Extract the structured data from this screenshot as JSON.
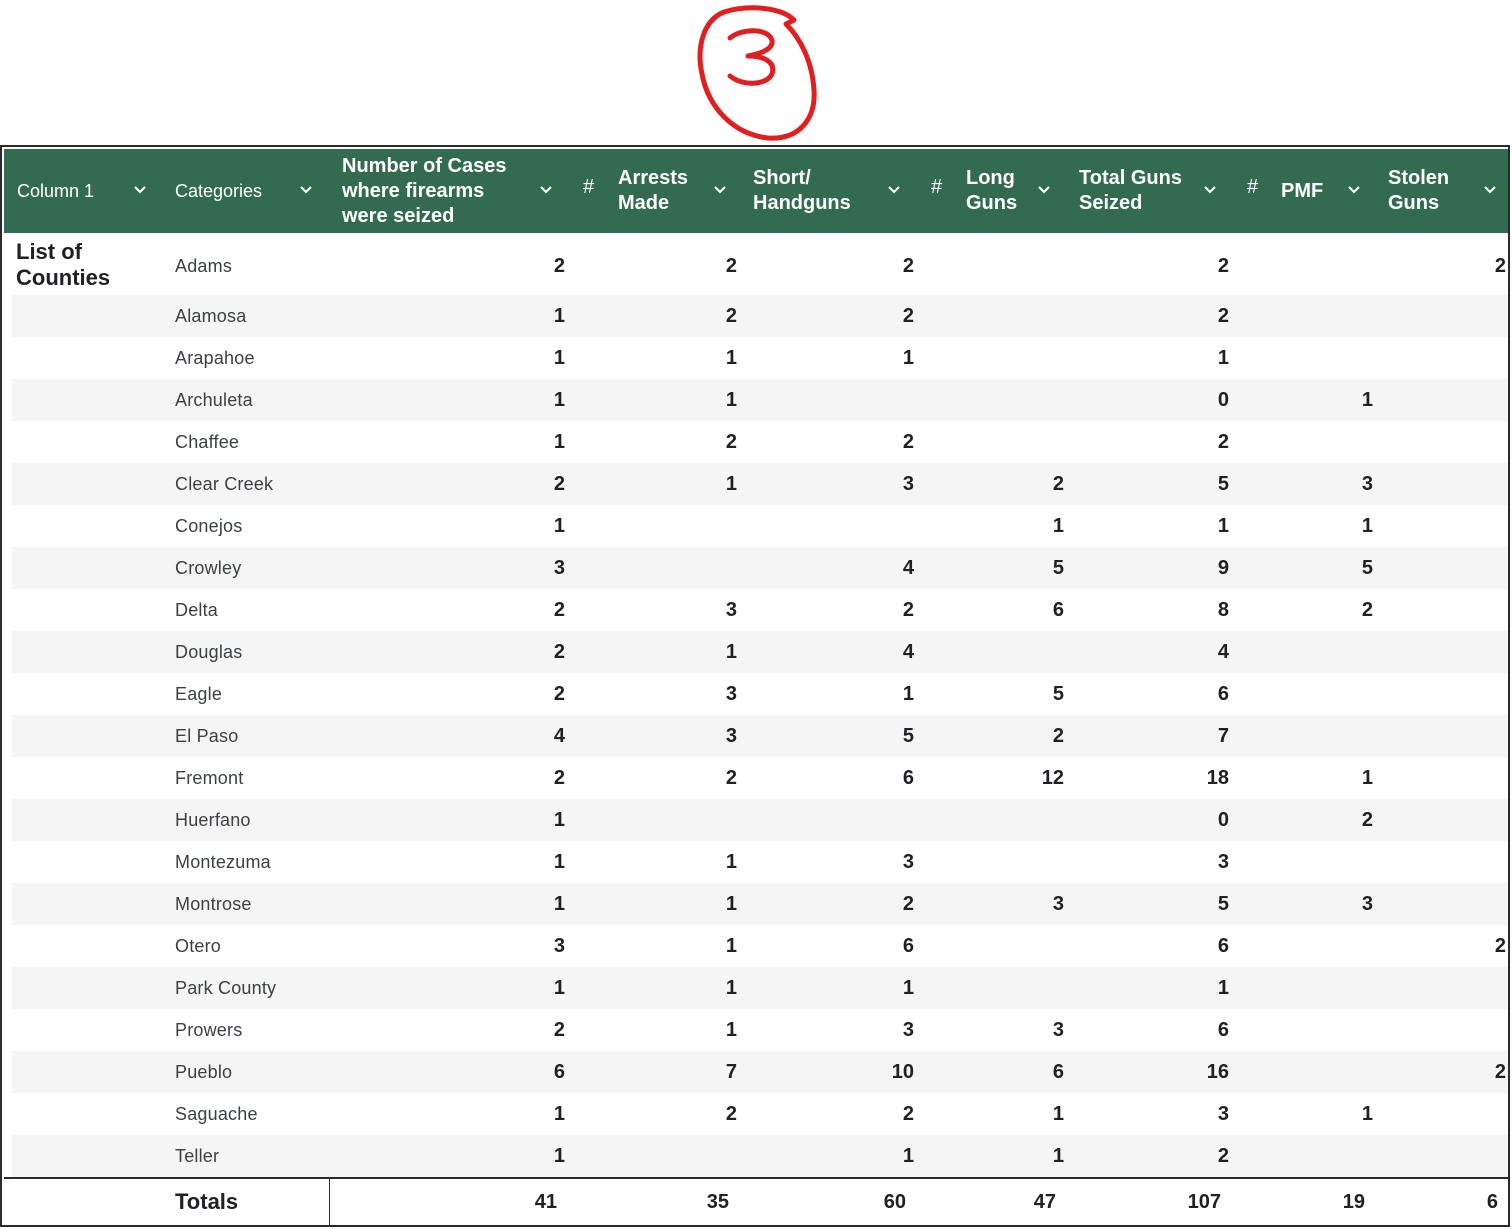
{
  "annotation": {
    "text": "3",
    "color": "#e02020"
  },
  "theme": {
    "header_bg": "#336b51",
    "header_text": "#ffffff",
    "stripe": "#f5f5f5"
  },
  "header": {
    "col1": "Column 1",
    "categories": "Categories",
    "cases": "Number of Cases\nwhere firearms\nwere seized",
    "hash_arrests": "#",
    "arrests": "Arrests\nMade",
    "short": "Short/\nHandguns",
    "hash_long": "#",
    "long": "Long\nGuns",
    "total": "Total Guns\nSeized",
    "hash_pmf": "#",
    "pmf": "PMF",
    "stolen": "Stolen\nGuns"
  },
  "group_label": "List of\nCounties",
  "rows": [
    {
      "county": "Adams",
      "cases": "2",
      "arrests": "2",
      "short": "2",
      "long": "",
      "total": "2",
      "pmf": "",
      "stolen": "2"
    },
    {
      "county": "Alamosa",
      "cases": "1",
      "arrests": "2",
      "short": "2",
      "long": "",
      "total": "2",
      "pmf": "",
      "stolen": ""
    },
    {
      "county": "Arapahoe",
      "cases": "1",
      "arrests": "1",
      "short": "1",
      "long": "",
      "total": "1",
      "pmf": "",
      "stolen": ""
    },
    {
      "county": "Archuleta",
      "cases": "1",
      "arrests": "1",
      "short": "",
      "long": "",
      "total": "0",
      "pmf": "1",
      "stolen": ""
    },
    {
      "county": "Chaffee",
      "cases": "1",
      "arrests": "2",
      "short": "2",
      "long": "",
      "total": "2",
      "pmf": "",
      "stolen": ""
    },
    {
      "county": "Clear Creek",
      "cases": "2",
      "arrests": "1",
      "short": "3",
      "long": "2",
      "total": "5",
      "pmf": "3",
      "stolen": ""
    },
    {
      "county": "Conejos",
      "cases": "1",
      "arrests": "",
      "short": "",
      "long": "1",
      "total": "1",
      "pmf": "1",
      "stolen": ""
    },
    {
      "county": "Crowley",
      "cases": "3",
      "arrests": "",
      "short": "4",
      "long": "5",
      "total": "9",
      "pmf": "5",
      "stolen": ""
    },
    {
      "county": "Delta",
      "cases": "2",
      "arrests": "3",
      "short": "2",
      "long": "6",
      "total": "8",
      "pmf": "2",
      "stolen": ""
    },
    {
      "county": "Douglas",
      "cases": "2",
      "arrests": "1",
      "short": "4",
      "long": "",
      "total": "4",
      "pmf": "",
      "stolen": ""
    },
    {
      "county": "Eagle",
      "cases": "2",
      "arrests": "3",
      "short": "1",
      "long": "5",
      "total": "6",
      "pmf": "",
      "stolen": ""
    },
    {
      "county": "El Paso",
      "cases": "4",
      "arrests": "3",
      "short": "5",
      "long": "2",
      "total": "7",
      "pmf": "",
      "stolen": ""
    },
    {
      "county": "Fremont",
      "cases": "2",
      "arrests": "2",
      "short": "6",
      "long": "12",
      "total": "18",
      "pmf": "1",
      "stolen": ""
    },
    {
      "county": "Huerfano",
      "cases": "1",
      "arrests": "",
      "short": "",
      "long": "",
      "total": "0",
      "pmf": "2",
      "stolen": ""
    },
    {
      "county": "Montezuma",
      "cases": "1",
      "arrests": "1",
      "short": "3",
      "long": "",
      "total": "3",
      "pmf": "",
      "stolen": ""
    },
    {
      "county": "Montrose",
      "cases": "1",
      "arrests": "1",
      "short": "2",
      "long": "3",
      "total": "5",
      "pmf": "3",
      "stolen": ""
    },
    {
      "county": "Otero",
      "cases": "3",
      "arrests": "1",
      "short": "6",
      "long": "",
      "total": "6",
      "pmf": "",
      "stolen": "2"
    },
    {
      "county": "Park County",
      "cases": "1",
      "arrests": "1",
      "short": "1",
      "long": "",
      "total": "1",
      "pmf": "",
      "stolen": ""
    },
    {
      "county": "Prowers",
      "cases": "2",
      "arrests": "1",
      "short": "3",
      "long": "3",
      "total": "6",
      "pmf": "",
      "stolen": ""
    },
    {
      "county": "Pueblo",
      "cases": "6",
      "arrests": "7",
      "short": "10",
      "long": "6",
      "total": "16",
      "pmf": "",
      "stolen": "2"
    },
    {
      "county": "Saguache",
      "cases": "1",
      "arrests": "2",
      "short": "2",
      "long": "1",
      "total": "3",
      "pmf": "1",
      "stolen": ""
    },
    {
      "county": "Teller",
      "cases": "1",
      "arrests": "",
      "short": "1",
      "long": "1",
      "total": "2",
      "pmf": "",
      "stolen": ""
    }
  ],
  "totals": {
    "label": "Totals",
    "cases": "41",
    "arrests": "35",
    "short": "60",
    "long": "47",
    "total": "107",
    "pmf": "19",
    "stolen": "6"
  }
}
